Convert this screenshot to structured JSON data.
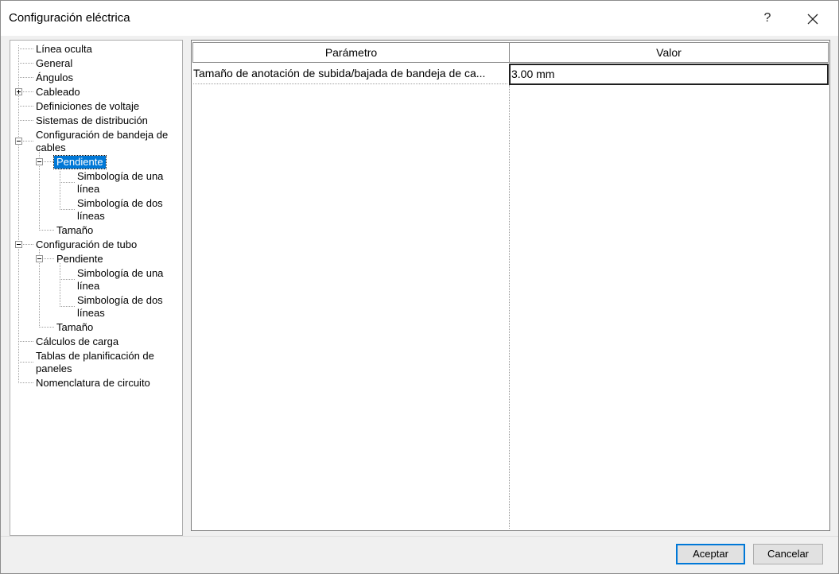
{
  "window": {
    "title": "Configuración eléctrica",
    "help_label": "?",
    "close_label": "✕"
  },
  "tree": {
    "items": [
      {
        "label": "Línea oculta"
      },
      {
        "label": "General"
      },
      {
        "label": "Ángulos"
      },
      {
        "label": "Cableado",
        "expander": "+"
      },
      {
        "label": "Definiciones de voltaje"
      },
      {
        "label": "Sistemas de distribución"
      },
      {
        "label": "Configuración de bandeja de\ncables",
        "expander": "-"
      },
      {
        "label": "Pendiente",
        "expander": "-",
        "selected": true
      },
      {
        "label": "Simbología de una\nlínea"
      },
      {
        "label": "Simbología de dos\nlíneas"
      },
      {
        "label": "Tamaño"
      },
      {
        "label": "Configuración de tubo",
        "expander": "-"
      },
      {
        "label": "Pendiente",
        "expander": "-"
      },
      {
        "label": "Simbología de una\nlínea"
      },
      {
        "label": "Simbología de dos\nlíneas"
      },
      {
        "label": "Tamaño"
      },
      {
        "label": "Cálculos de carga"
      },
      {
        "label": "Tablas de planificación de\npaneles"
      },
      {
        "label": "Nomenclatura de circuito"
      }
    ]
  },
  "grid": {
    "headers": {
      "param": "Parámetro",
      "value": "Valor"
    },
    "rows": [
      {
        "param": "Tamaño de anotación de subida/bajada de bandeja de ca...",
        "value": "3.00 mm"
      }
    ]
  },
  "buttons": {
    "ok": "Aceptar",
    "cancel": "Cancelar"
  },
  "colors": {
    "selection": "#0078d7",
    "default_button_border": "#0078d7"
  }
}
